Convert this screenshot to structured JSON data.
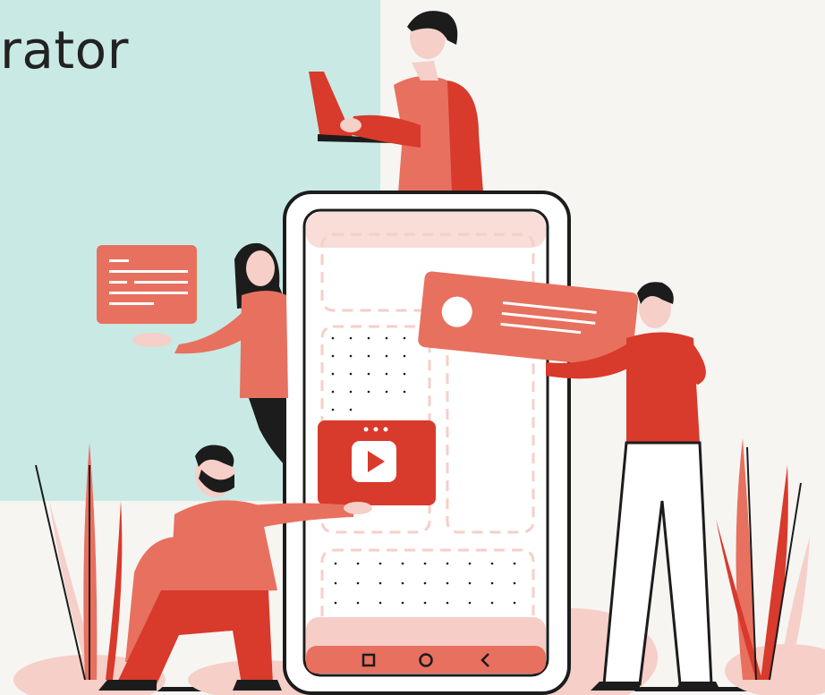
{
  "header": {
    "title_fragment": "rator"
  },
  "colors": {
    "teal_panel": "#c9e9e4",
    "coral": "#e8705f",
    "red": "#d83a2b",
    "pink_light": "#f5cfc8",
    "dark": "#1c1c1c",
    "background": "#f6f5f2"
  },
  "icons": {
    "nav_square": "square-icon",
    "nav_circle": "circle-icon",
    "nav_back": "back-chevron-icon",
    "media": "play-icon"
  }
}
